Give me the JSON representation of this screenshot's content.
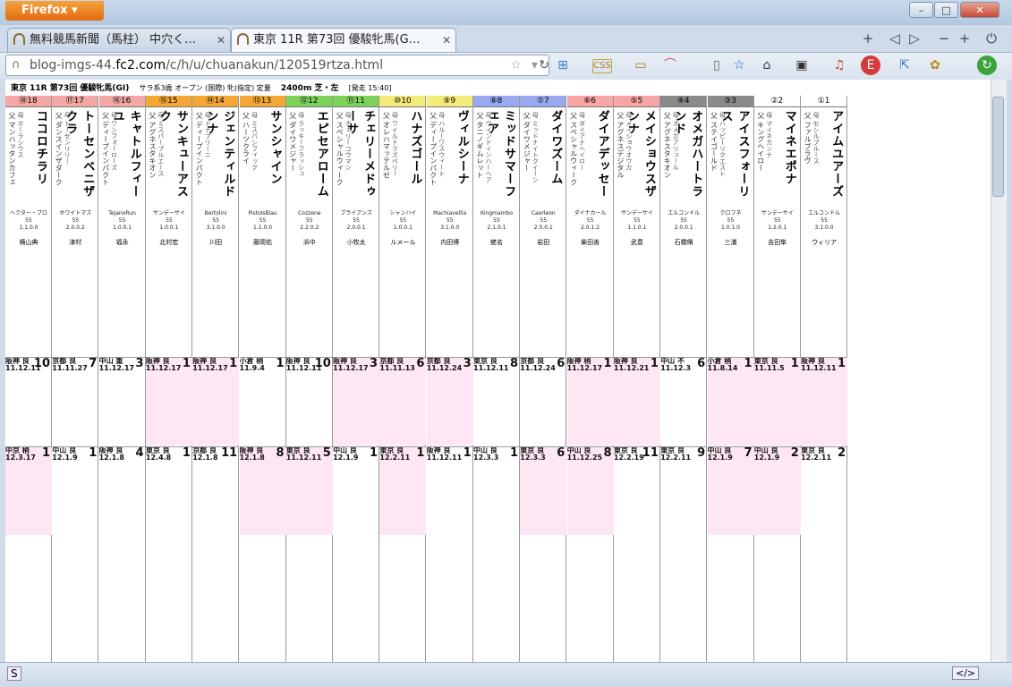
{
  "browser": {
    "menu_label": "Firefox ▾",
    "tabs": [
      {
        "title": "無料競馬新聞（馬柱） 中穴く…",
        "active": false
      },
      {
        "title": "東京 11R 第73回 優駿牝馬(G…",
        "active": true
      }
    ],
    "url_prefix": "blog-imgs-44.",
    "url_domain": "fc2.com",
    "url_path": "/c/h/u/chuanakun/120519rtza.html",
    "window_controls": {
      "minimize": "–",
      "maximize": "□",
      "close": "✕"
    }
  },
  "race": {
    "title": "東京 11R 第73回 優駿牝馬(GI)",
    "conditions": "サラ系3歳 オープン (国際) 牝(指定) 定量",
    "distance": "2400m 芝・左",
    "post_time": "[発走 15:40]"
  },
  "horses": [
    {
      "gate": "⑱18",
      "gate_color": "#f4a7a7",
      "name": "ココロチラリ",
      "sire": "父 マンハッタンカフェ",
      "dam": "母 ホーラシウス",
      "breeder": "ヘクター・プロ",
      "jockey": "横山典",
      "weight": "55",
      "odds": "1.1.0.0"
    },
    {
      "gate": "⑰17",
      "gate_color": "#f4a7a7",
      "name": "トーセンベニザクラ",
      "sire": "父 ダンスインザダーク",
      "dam": "母 トーセンリリー",
      "breeder": "ホワイトマズ",
      "jockey": "津村",
      "weight": "55",
      "odds": "2.0.0.2"
    },
    {
      "gate": "⑯16",
      "gate_color": "#f4a7a7",
      "name": "キャトルフィーユ",
      "sire": "父 ディープインパクト",
      "dam": "母 ワンフォーローズ",
      "breeder": "TejanoRun",
      "jockey": "福永",
      "weight": "55",
      "odds": "1.0.0.1"
    },
    {
      "gate": "⑮15",
      "gate_color": "#f5a733",
      "name": "サンキューアスク",
      "sire": "父 アグネスタキオン",
      "dam": "母 ミスパープルエース",
      "breeder": "サンデーサイ",
      "jockey": "北村宏",
      "weight": "55",
      "odds": "1.0.0.1"
    },
    {
      "gate": "⑭14",
      "gate_color": "#f5a733",
      "name": "ジェンティルドンナ",
      "sire": "父 ディープインパクト",
      "dam": "母 ドナブリーニ",
      "breeder": "Bertolini",
      "jockey": "川田",
      "weight": "55",
      "odds": "3.1.0.0"
    },
    {
      "gate": "⑬13",
      "gate_color": "#f5a733",
      "name": "サンシャイン",
      "sire": "父 ハーツクライ",
      "dam": "母 ミスパシフィック",
      "breeder": "PistolsBlau",
      "jockey": "藤岡佑",
      "weight": "55",
      "odds": "1.1.0.0"
    },
    {
      "gate": "⑫12",
      "gate_color": "#7dd35a",
      "name": "エピセアローム",
      "sire": "父 ダイワメジャー",
      "dam": "母 ラッキーフラッシュ",
      "breeder": "Cozzene",
      "jockey": "浜中",
      "weight": "55",
      "odds": "2.2.0.2"
    },
    {
      "gate": "⑪11",
      "gate_color": "#7dd35a",
      "name": "チェリーメドゥーサ",
      "sire": "父 スペシャルウィーク",
      "dam": "母 チェリーコウマン",
      "breeder": "ブライアンズ",
      "jockey": "小牧太",
      "weight": "55",
      "odds": "2.0.0.1"
    },
    {
      "gate": "⑩10",
      "gate_color": "#f3ec7a",
      "name": "ハナズゴール",
      "sire": "父 オレハマッテルゼ",
      "dam": "母 ワイルドラズベリー",
      "breeder": "シャンハイ",
      "jockey": "ルメール",
      "weight": "55",
      "odds": "1.0.0.1"
    },
    {
      "gate": "⑨9",
      "gate_color": "#f3ec7a",
      "name": "ヴィルシーナ",
      "sire": "父 ディープインパクト",
      "dam": "母 ハルーワスウィート",
      "breeder": "Machiavellia",
      "jockey": "内田博",
      "weight": "55",
      "odds": "3.1.0.0"
    },
    {
      "gate": "⑧8",
      "gate_color": "#9aa8f0",
      "name": "ミッドサマーフェア",
      "sire": "父 タニノギムレット",
      "dam": "母 ウインドインハーヘア",
      "breeder": "Kingmambo",
      "jockey": "蛯名",
      "weight": "55",
      "odds": "2.1.0.1"
    },
    {
      "gate": "⑦7",
      "gate_color": "#9aa8f0",
      "name": "ダイワズーム",
      "sire": "父 ダイワメジャー",
      "dam": "母 ミッドナイトクイーン",
      "breeder": "Caerleon",
      "jockey": "岩田",
      "weight": "55",
      "odds": "2.0.0.1"
    },
    {
      "gate": "⑥6",
      "gate_color": "#f7a5a5",
      "name": "ダイアデッセー",
      "sire": "父 スペシャルウィーク",
      "dam": "母 ダイアナヘイロー",
      "breeder": "ダイナカール",
      "jockey": "柴田善",
      "weight": "55",
      "odds": "2.0.1.2"
    },
    {
      "gate": "⑤5",
      "gate_color": "#f7a5a5",
      "name": "メイショウスザンナ",
      "sire": "父 アグネスデジタル",
      "dam": "母 メイショウオウカ",
      "breeder": "サンデーサイ",
      "jockey": "武豊",
      "weight": "55",
      "odds": "1.1.0.1"
    },
    {
      "gate": "④4",
      "gate_color": "#8a8a8a",
      "name": "オメガハートランド",
      "sire": "父 アグネスタキオン",
      "dam": "母 オメガアリュール",
      "breeder": "エルコンドル",
      "jockey": "石橋脩",
      "weight": "55",
      "odds": "2.0.0.1"
    },
    {
      "gate": "③3",
      "gate_color": "#8a8a8a",
      "name": "アイスフォーリス",
      "sire": "父 ステイゴールド",
      "dam": "母 ハッピーリクエスト",
      "breeder": "クロフネ",
      "jockey": "三浦",
      "weight": "55",
      "odds": "1.0.1.0"
    },
    {
      "gate": "②2",
      "gate_color": "#ffffff",
      "name": "マイネエポナ",
      "sire": "父 キングヘイロー",
      "dam": "母 マイネカンナ",
      "breeder": "サンデーサイ",
      "jockey": "吉田隼",
      "weight": "55",
      "odds": "1.2.0.1"
    },
    {
      "gate": "①1",
      "gate_color": "#ffffff",
      "name": "アイムユアーズ",
      "sire": "父 ファルブラヴ",
      "dam": "母 セシルブルース",
      "breeder": "エルコンドル",
      "jockey": "ウィリア",
      "weight": "55",
      "odds": "3.1.0.0"
    }
  ],
  "past_races": [
    [
      "阪神 良 11.12.11",
      "京都 良 11.11.27",
      "中山 重 11.12.17",
      "阪神 良 11.12.17",
      "阪神 良 11.12.17",
      "小倉 稍 11.9.4",
      "阪神 良 11.12.11",
      "阪神 良 11.12.17",
      "京都 良 11.11.13",
      "京都 良 11.12.24",
      "東京 良 11.12.11",
      "京都 良 11.12.24",
      "阪神 稍 11.12.17",
      "阪神 良 11.12.21",
      "中山 不 11.12.3",
      "小倉 稍 11.8.14",
      "東京 良 11.11.5",
      "阪神 良 11.12.11"
    ],
    [
      "中京 稍 12.3.17",
      "中山 良 12.1.9",
      "阪神 良 12.1.8",
      "東京 良 12.4.8",
      "京都 良 12.1.8",
      "阪神 良 12.1.8",
      "東京 良 11.12.11",
      "中山 良 12.1.9",
      "東京 良 12.2.11",
      "阪神 良 11.12.11",
      "中山 良 12.3.3",
      "東京 良 12.3.3",
      "中山 良 11.12.25",
      "東京 良 12.2.19",
      "東京 良 12.2.11",
      "中山 良 12.1.9",
      "中山 良 12.1.9",
      "東京 良 12.2.11"
    ]
  ],
  "race_results": {
    "row1": [
      "10",
      "7",
      "3",
      "1",
      "1",
      "1",
      "10",
      "3",
      "6",
      "3",
      "8",
      "6",
      "1",
      "1",
      "6",
      "1",
      "1",
      "1"
    ],
    "row2": [
      "1",
      "1",
      "4",
      "1",
      "11",
      "8",
      "5",
      "1",
      "1",
      "1",
      "1",
      "6",
      "8",
      "11",
      "9",
      "7",
      "2",
      "2"
    ]
  },
  "status": {
    "left_icon": "S",
    "right_icon": "</>"
  }
}
